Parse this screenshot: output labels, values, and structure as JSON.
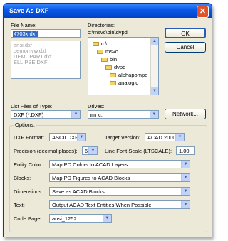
{
  "window": {
    "title": "Save As DXF",
    "close_glyph": "✕"
  },
  "file_name": {
    "label": "File Name:",
    "value": "4703x.dxf",
    "files": [
      "ansi.dxf",
      "demomvw.dxf",
      "DEMOPART.dxf",
      "ELLIPSE.DXF"
    ]
  },
  "directories": {
    "label": "Directories:",
    "path": "c:\\msvc\\bin\\dvpd",
    "items": [
      "c:\\",
      "msvc",
      "bin",
      "dvpd",
      "alphapompe",
      "analogic"
    ]
  },
  "buttons": {
    "ok": "OK",
    "cancel": "Cancel",
    "network": "Network..."
  },
  "file_type": {
    "label": "List Files of Type:",
    "value": "DXF (*.DXF)"
  },
  "drives": {
    "label": "Drives:",
    "value": "c:"
  },
  "options": {
    "legend": "Options:",
    "dxf_format": {
      "label": "DXF Format:",
      "value": "ASCII DXF"
    },
    "target_version": {
      "label": "Target Version:",
      "value": "ACAD 2000"
    },
    "precision": {
      "label": "Precision (decimal places):",
      "value": "6"
    },
    "line_font_scale": {
      "label": "Line Font Scale (LTSCALE):",
      "value": "1.00"
    },
    "entity_color": {
      "label": "Entity Color:",
      "value": "Map PD Colors to ACAD Layers"
    },
    "blocks": {
      "label": "Blocks:",
      "value": "Map PD Figures to ACAD Blocks"
    },
    "dimensions": {
      "label": "Dimensions:",
      "value": "Save as ACAD Blocks"
    },
    "text": {
      "label": "Text:",
      "value": "Output ACAD Text Entities When Possible"
    },
    "code_page": {
      "label": "Code Page:",
      "value": "ansi_1252"
    }
  },
  "icons": {
    "dropdown": "chevron-down-icon",
    "folder": "folder-icon",
    "drive": "drive-icon"
  }
}
